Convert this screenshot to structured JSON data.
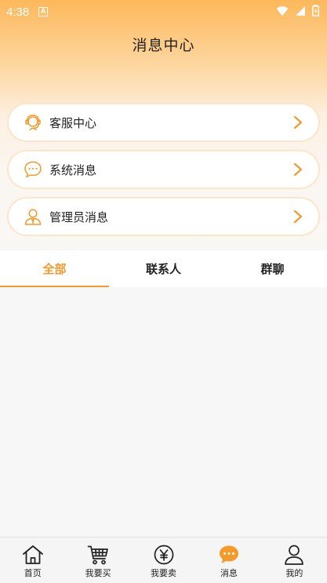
{
  "status_bar": {
    "time": "4:38",
    "notification_letter": "A"
  },
  "page": {
    "title": "消息中心"
  },
  "menu": [
    {
      "label": "客服中心",
      "icon": "headset-icon"
    },
    {
      "label": "系统消息",
      "icon": "chat-bubble-icon"
    },
    {
      "label": "管理员消息",
      "icon": "admin-person-icon"
    }
  ],
  "tabs": [
    {
      "label": "全部",
      "active": true
    },
    {
      "label": "联系人",
      "active": false
    },
    {
      "label": "群聊",
      "active": false
    }
  ],
  "bottom_nav": [
    {
      "label": "首页",
      "icon": "home-icon"
    },
    {
      "label": "我要买",
      "icon": "cart-icon"
    },
    {
      "label": "我要卖",
      "icon": "yen-coin-icon"
    },
    {
      "label": "消息",
      "icon": "message-icon",
      "active": true
    },
    {
      "label": "我的",
      "icon": "user-icon"
    }
  ],
  "colors": {
    "accent": "#f39a2b",
    "header_top": "#fdb85a",
    "card_border": "#fde6c8"
  }
}
